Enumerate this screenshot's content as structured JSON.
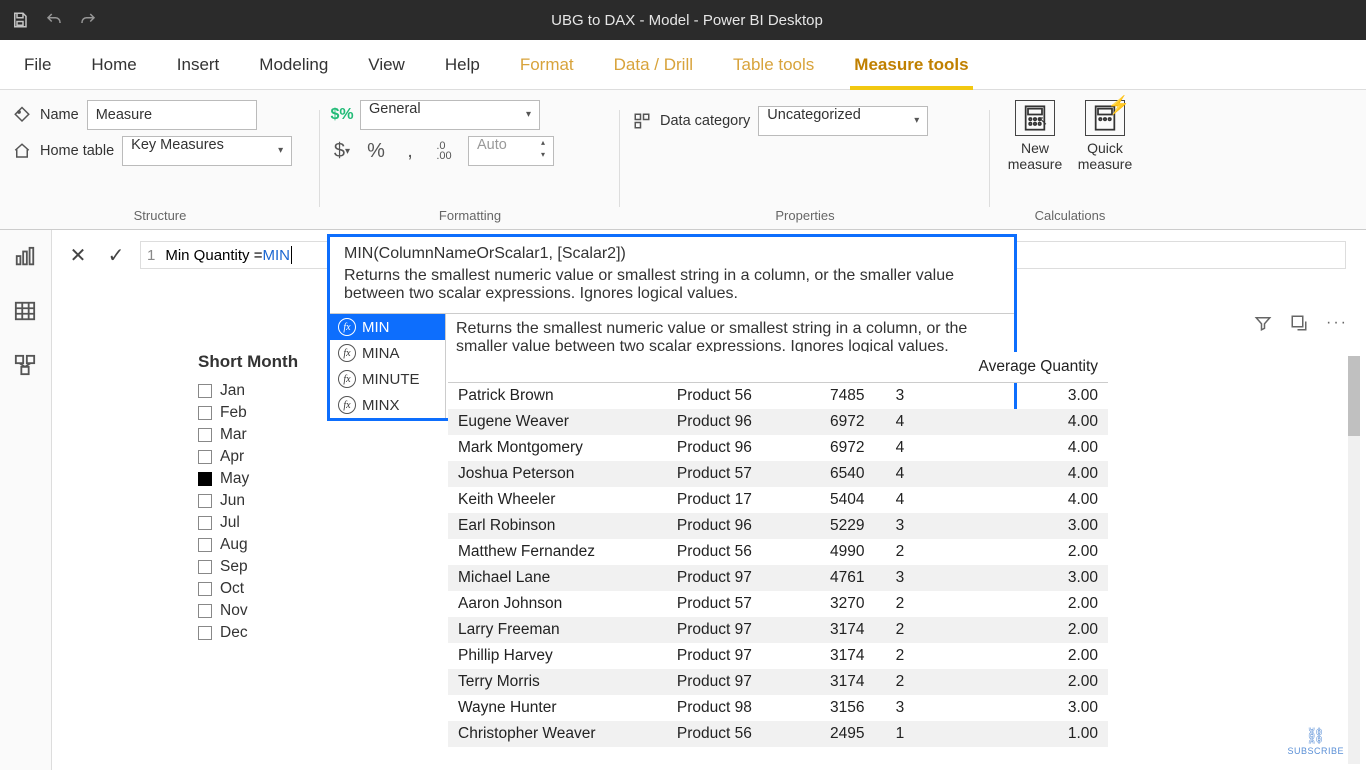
{
  "app_title": "UBG to DAX - Model - Power BI Desktop",
  "tabs": [
    "File",
    "Home",
    "Insert",
    "Modeling",
    "View",
    "Help",
    "Format",
    "Data / Drill",
    "Table tools",
    "Measure tools"
  ],
  "active_tab": "Measure tools",
  "contextual_tabs": [
    "Format",
    "Data / Drill",
    "Table tools",
    "Measure tools"
  ],
  "ribbon": {
    "structure": {
      "name_label": "Name",
      "name_value": "Measure",
      "hometable_label": "Home table",
      "hometable_value": "Key Measures",
      "group": "Structure"
    },
    "formatting": {
      "label": "Formatting",
      "format_value": "General",
      "auto": "Auto"
    },
    "properties": {
      "label": "Properties",
      "datacat_label": "Data category",
      "datacat_value": "Uncategorized"
    },
    "calculations": {
      "label": "Calculations",
      "newmeasure": "New measure",
      "quickmeasure": "Quick measure"
    }
  },
  "formula": {
    "lineno": "1",
    "prefix": "Min Quantity = ",
    "typed": "MIN",
    "sig": "MIN(ColumnNameOrScalar1, [Scalar2])",
    "sig_desc": "Returns the smallest numeric value or smallest string in a column, or the smaller value between two scalar expressions. Ignores logical values.",
    "options": [
      "MIN",
      "MINA",
      "MINUTE",
      "MINX"
    ],
    "sel": "MIN",
    "sel_desc": "Returns the smallest numeric value or smallest string in a column, or the smaller value between two scalar expressions. Ignores logical values."
  },
  "slicer": {
    "title": "Short Month",
    "items": [
      {
        "l": "Jan",
        "c": false
      },
      {
        "l": "Feb",
        "c": false
      },
      {
        "l": "Mar",
        "c": false
      },
      {
        "l": "Apr",
        "c": false
      },
      {
        "l": "May",
        "c": true
      },
      {
        "l": "Jun",
        "c": false
      },
      {
        "l": "Jul",
        "c": false
      },
      {
        "l": "Aug",
        "c": false
      },
      {
        "l": "Sep",
        "c": false
      },
      {
        "l": "Oct",
        "c": false
      },
      {
        "l": "Nov",
        "c": false
      },
      {
        "l": "Dec",
        "c": false
      }
    ]
  },
  "table": {
    "headers": [
      "",
      "",
      "",
      "",
      "Average Quantity"
    ],
    "rows": [
      [
        "Patrick Brown",
        "Product 56",
        "7485",
        "3",
        "3.00"
      ],
      [
        "Eugene Weaver",
        "Product 96",
        "6972",
        "4",
        "4.00"
      ],
      [
        "Mark Montgomery",
        "Product 96",
        "6972",
        "4",
        "4.00"
      ],
      [
        "Joshua Peterson",
        "Product 57",
        "6540",
        "4",
        "4.00"
      ],
      [
        "Keith Wheeler",
        "Product 17",
        "5404",
        "4",
        "4.00"
      ],
      [
        "Earl Robinson",
        "Product 96",
        "5229",
        "3",
        "3.00"
      ],
      [
        "Matthew Fernandez",
        "Product 56",
        "4990",
        "2",
        "2.00"
      ],
      [
        "Michael Lane",
        "Product 97",
        "4761",
        "3",
        "3.00"
      ],
      [
        "Aaron Johnson",
        "Product 57",
        "3270",
        "2",
        "2.00"
      ],
      [
        "Larry Freeman",
        "Product 97",
        "3174",
        "2",
        "2.00"
      ],
      [
        "Phillip Harvey",
        "Product 97",
        "3174",
        "2",
        "2.00"
      ],
      [
        "Terry Morris",
        "Product 97",
        "3174",
        "2",
        "2.00"
      ],
      [
        "Wayne Hunter",
        "Product 98",
        "3156",
        "3",
        "3.00"
      ],
      [
        "Christopher Weaver",
        "Product 56",
        "2495",
        "1",
        "1.00"
      ]
    ]
  },
  "subscribe": "SUBSCRIBE"
}
